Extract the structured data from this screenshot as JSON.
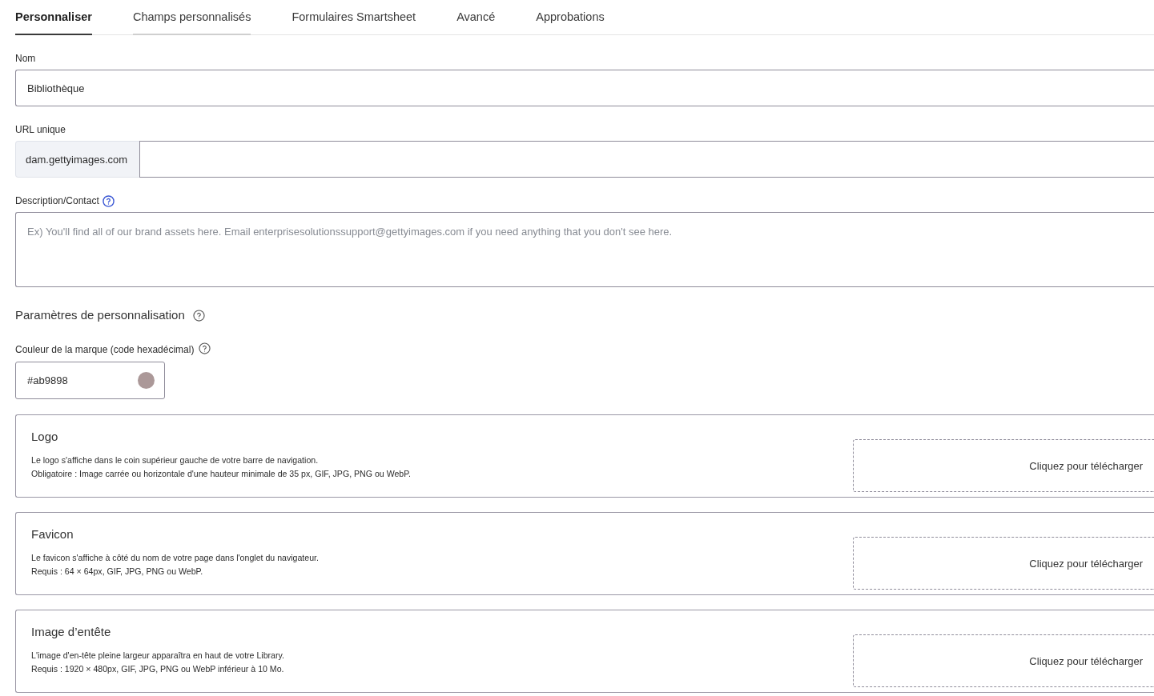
{
  "tabs": [
    {
      "label": "Personnaliser",
      "selected": true,
      "hovered": false
    },
    {
      "label": "Champs personnalisés",
      "selected": false,
      "hovered": true
    },
    {
      "label": "Formulaires Smartsheet",
      "selected": false,
      "hovered": false
    },
    {
      "label": "Avancé",
      "selected": false,
      "hovered": false
    },
    {
      "label": "Approbations",
      "selected": false,
      "hovered": false
    }
  ],
  "name_field": {
    "label": "Nom",
    "value": "Bibliothèque"
  },
  "url_field": {
    "label": "URL unique",
    "prefix": "dam.gettyimages.com"
  },
  "description_field": {
    "label": "Description/Contact",
    "help_active": true,
    "placeholder": "Ex) You'll find all of our brand assets here. Email enterprisesolutionssupport@gettyimages.com if you need anything that you don't see here."
  },
  "customization": {
    "title": "Paramètres de personnalisation",
    "help_active": false,
    "brand_color": {
      "label": "Couleur de la marque (code hexadécimal)",
      "help_active": false,
      "value": "#ab9898",
      "color": "#ab9898"
    },
    "uploads": [
      {
        "title": "Logo",
        "lines": [
          "Le logo s'affiche dans le coin supérieur gauche de votre barre de navigation.",
          "Obligatoire : Image carrée ou horizontale d'une hauteur minimale de 35 px, GIF, JPG, PNG ou WebP."
        ],
        "action": "Cliquez pour télécharger"
      },
      {
        "title": "Favicon",
        "lines": [
          "Le favicon s'affiche à côté du nom de votre page dans l'onglet du navigateur.",
          "Requis : 64 × 64px, GIF, JPG, PNG ou WebP."
        ],
        "action": "Cliquez pour télécharger"
      },
      {
        "title": "Image d’entête",
        "lines": [
          "L'image d'en-tête pleine largeur apparaîtra en haut de votre Library.",
          "Requis : 1920 × 480px, GIF, JPG, PNG ou WebP inférieur à 10 Mo."
        ],
        "action": "Cliquez pour télécharger"
      }
    ]
  }
}
